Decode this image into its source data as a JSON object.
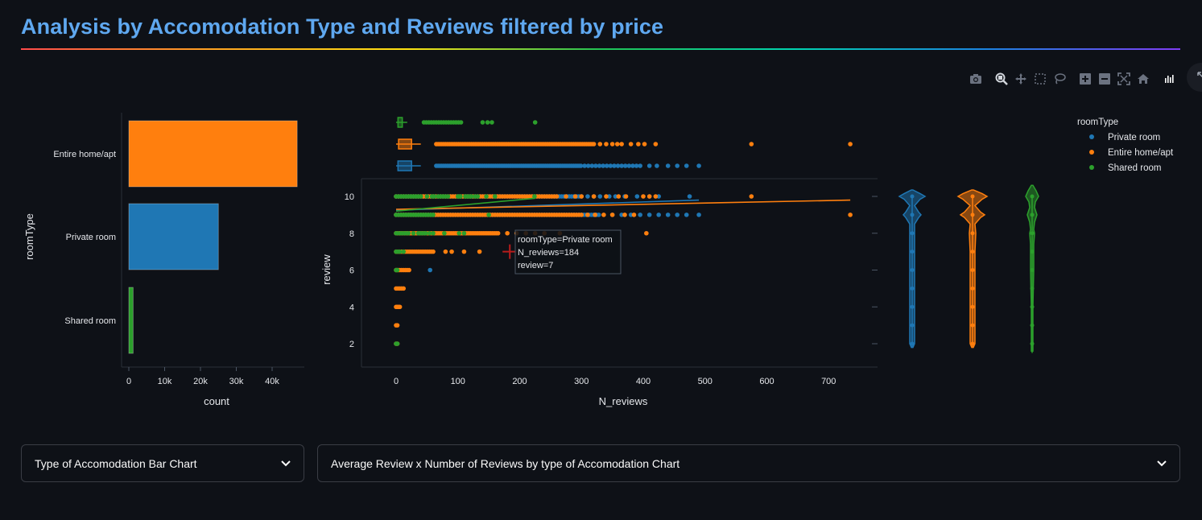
{
  "title": "Analysis by Accomodation Type and Reviews filtered by price",
  "modebar": {
    "icons": [
      "camera-icon",
      "zoom-icon",
      "pan-icon",
      "box-select-icon",
      "lasso-icon",
      "zoom-in-icon",
      "zoom-out-icon",
      "autoscale-icon",
      "reset-axes-icon",
      "plotly-logo-icon"
    ]
  },
  "colors": {
    "private": "#1f77b4",
    "entire": "#ff7f0e",
    "shared": "#2ca02c",
    "background": "#0e1117",
    "title": "#5fa8f0"
  },
  "chart_data": [
    {
      "type": "bar",
      "orientation": "horizontal",
      "categories": [
        "Entire home/apt",
        "Private room",
        "Shared room"
      ],
      "values": [
        47000,
        25000,
        1200
      ],
      "xlabel": "count",
      "ylabel": "roomType",
      "xticks": [
        "0",
        "10k",
        "20k",
        "30k",
        "40k"
      ],
      "xlim": [
        0,
        48000
      ]
    },
    {
      "type": "scatter",
      "xlabel": "N_reviews",
      "ylabel": "review",
      "xticks": [
        "0",
        "100",
        "200",
        "300",
        "400",
        "500",
        "600",
        "700"
      ],
      "yticks": [
        "2",
        "4",
        "6",
        "8",
        "10"
      ],
      "xlim": [
        -55,
        780
      ],
      "ylim": [
        0.7,
        11
      ],
      "legend_title": "roomType",
      "legend_position": "top-right",
      "series": [
        {
          "name": "Private room",
          "color": "#1f77b4",
          "marginal_box_max": 490,
          "trend": [
            [
              0,
              9.25
            ],
            [
              490,
              9.8
            ]
          ]
        },
        {
          "name": "Entire home/apt",
          "color": "#ff7f0e",
          "marginal_box_max": 735,
          "trend": [
            [
              0,
              9.3
            ],
            [
              735,
              9.8
            ]
          ]
        },
        {
          "name": "Shared room",
          "color": "#2ca02c",
          "marginal_box_max": 225,
          "trend": [
            [
              0,
              9.2
            ],
            [
              225,
              9.9
            ]
          ]
        }
      ],
      "hover": {
        "lines": [
          "roomType=Private room",
          "N_reviews=184",
          "review=7"
        ],
        "x": 184,
        "y": 7
      }
    }
  ],
  "expanders": [
    {
      "label": "Type of Accomodation Bar Chart"
    },
    {
      "label": "Average Review x Number of Reviews by type of Accomodation Chart"
    }
  ]
}
